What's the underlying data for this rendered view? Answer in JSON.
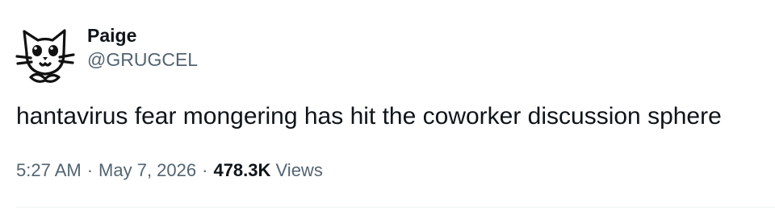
{
  "user": {
    "display_name": "Paige",
    "handle": "@GRUGCEL",
    "avatar_icon": "cat-face-doodle-icon"
  },
  "tweet": {
    "text": "hantavirus fear mongering has hit the coworker discussion sphere"
  },
  "meta": {
    "time": "5:27 AM",
    "separator": "·",
    "date": "May 7, 2026",
    "views_count": "478.3K",
    "views_label": "Views"
  },
  "colors": {
    "primary_text": "#0f1419",
    "secondary_text": "#536471",
    "divider": "#eff3f4"
  }
}
